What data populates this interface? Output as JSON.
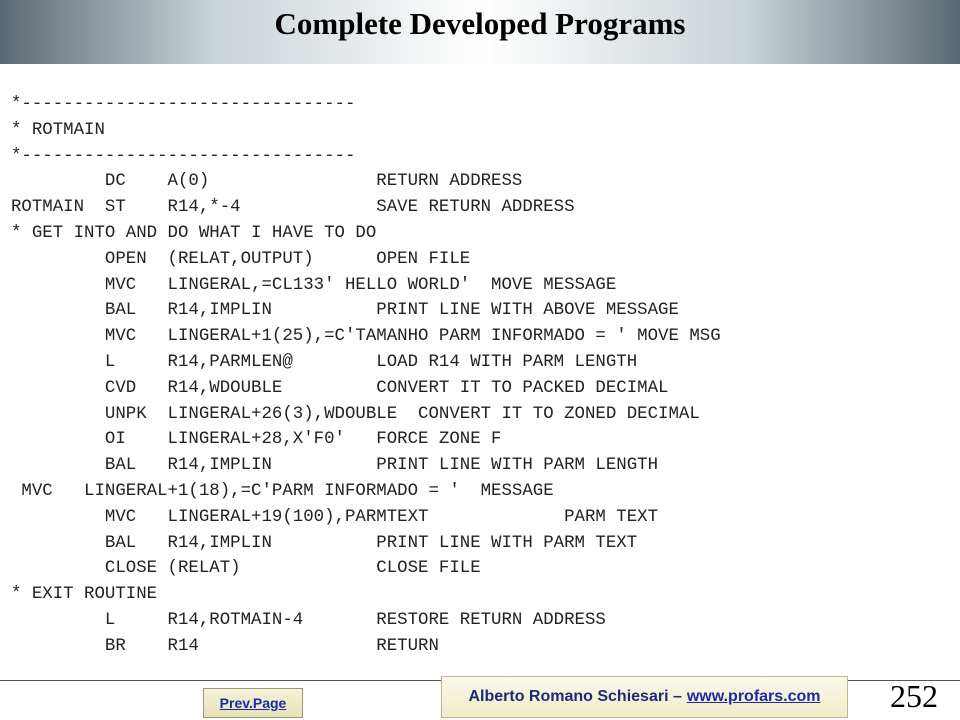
{
  "header": {
    "title": "Complete Developed Programs"
  },
  "code_lines": [
    "*--------------------------------",
    "* ROTMAIN",
    "*--------------------------------",
    "         DC    A(0)                RETURN ADDRESS",
    "ROTMAIN  ST    R14,*-4             SAVE RETURN ADDRESS",
    "* GET INTO AND DO WHAT I HAVE TO DO",
    "         OPEN  (RELAT,OUTPUT)      OPEN FILE",
    "         MVC   LINGERAL,=CL133' HELLO WORLD'  MOVE MESSAGE",
    "         BAL   R14,IMPLIN          PRINT LINE WITH ABOVE MESSAGE",
    "         MVC   LINGERAL+1(25),=C'TAMANHO PARM INFORMADO = ' MOVE MSG",
    "         L     R14,PARMLEN@        LOAD R14 WITH PARM LENGTH",
    "         CVD   R14,WDOUBLE         CONVERT IT TO PACKED DECIMAL",
    "         UNPK  LINGERAL+26(3),WDOUBLE  CONVERT IT TO ZONED DECIMAL",
    "         OI    LINGERAL+28,X'F0'   FORCE ZONE F",
    "         BAL   R14,IMPLIN          PRINT LINE WITH PARM LENGTH",
    " MVC   LINGERAL+1(18),=C'PARM INFORMADO = '  MESSAGE",
    "         MVC   LINGERAL+19(100),PARMTEXT             PARM TEXT",
    "         BAL   R14,IMPLIN          PRINT LINE WITH PARM TEXT",
    "         CLOSE (RELAT)             CLOSE FILE",
    "* EXIT ROUTINE",
    "         L     R14,ROTMAIN-4       RESTORE RETURN ADDRESS",
    "         BR    R14                 RETURN"
  ],
  "footer": {
    "prev_label": "Prev.Page",
    "author": "Alberto Romano Schiesari –",
    "website": "www.profars.com",
    "page_number": "252"
  }
}
